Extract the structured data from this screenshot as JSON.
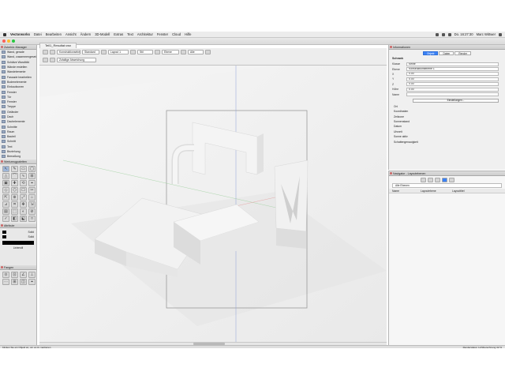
{
  "menubar": {
    "app": "Vectorworks",
    "items": [
      "Datei",
      "Bearbeiten",
      "Ansicht",
      "Ändern",
      "3D-Modell",
      "Extras",
      "Text",
      "Architektur",
      "Fenster",
      "Cloud",
      "Hilfe"
    ],
    "clock": "Do. 16:27:30",
    "user": "Marc Wittwer"
  },
  "window": {
    "title": "Teil1_Resultat.vwx"
  },
  "tabs": [
    {
      "label": "Teil1_Resultat.vwx"
    }
  ],
  "toolbar": {
    "dropdowns": [
      "Konstruktionsebene",
      "Standard",
      "Layout 1",
      "Stil",
      "Ebene",
      "Alle"
    ],
    "snap_label": "Zufallige Abweichung"
  },
  "library": {
    "title": "Zubehör-Manager",
    "items": [
      "Wand, gerade",
      "Wand, zusammengesetzt",
      "Schätze Wandbild",
      "Wände erstellen",
      "Wandelemente",
      "Fassade bearbeiten",
      "Bodenelemente",
      "Einkaufzonen",
      "Fenster",
      "Tür",
      "Fenster",
      "Treppe",
      "Geländer",
      "Dach",
      "Dachelemente",
      "Schnitte",
      "Raum",
      "Bauteil",
      "Schnitt",
      "Text",
      "Beziehung",
      "Bemaßung"
    ]
  },
  "tools_palette": {
    "title": "Werkzeugpaletten"
  },
  "attributes": {
    "title": "Attribute",
    "fill": "Solid",
    "pen": "Solid",
    "line": "Linienstil"
  },
  "snapping": {
    "title": "Fangen"
  },
  "info": {
    "title": "Informationen",
    "tabs": [
      "Objekt",
      "Daten",
      "Render"
    ],
    "object_type": "Schrank",
    "rows": [
      {
        "k": "Klasse",
        "v": "Keine"
      },
      {
        "k": "Ebene",
        "v": "Konstruktionsebene 1"
      },
      {
        "k": "X",
        "v": "0.00"
      },
      {
        "k": "Y",
        "v": "0.00"
      },
      {
        "k": "Z",
        "v": "0.00"
      },
      {
        "k": "Höhe",
        "v": "0.00"
      },
      {
        "k": "Name",
        "v": ""
      }
    ],
    "details": [
      "Ort",
      "Koordinaten",
      "Zeitzone",
      "Sonnenstand",
      "Datum",
      "Uhrzeit",
      "Sonne aktiv",
      "Schattengenauigkeit"
    ],
    "settings_btn": "Einstellungen..."
  },
  "navigator": {
    "title": "Navigator - Layoutebenen",
    "columns": [
      "Name",
      "Layoutebene",
      "Layouttitel"
    ],
    "search": "Alle Ebenen"
  },
  "status": {
    "left": "Klicken Sie ein Objekt an, um es zu markieren",
    "right": "Renderstatus: Lichtberechnung 42 %"
  }
}
